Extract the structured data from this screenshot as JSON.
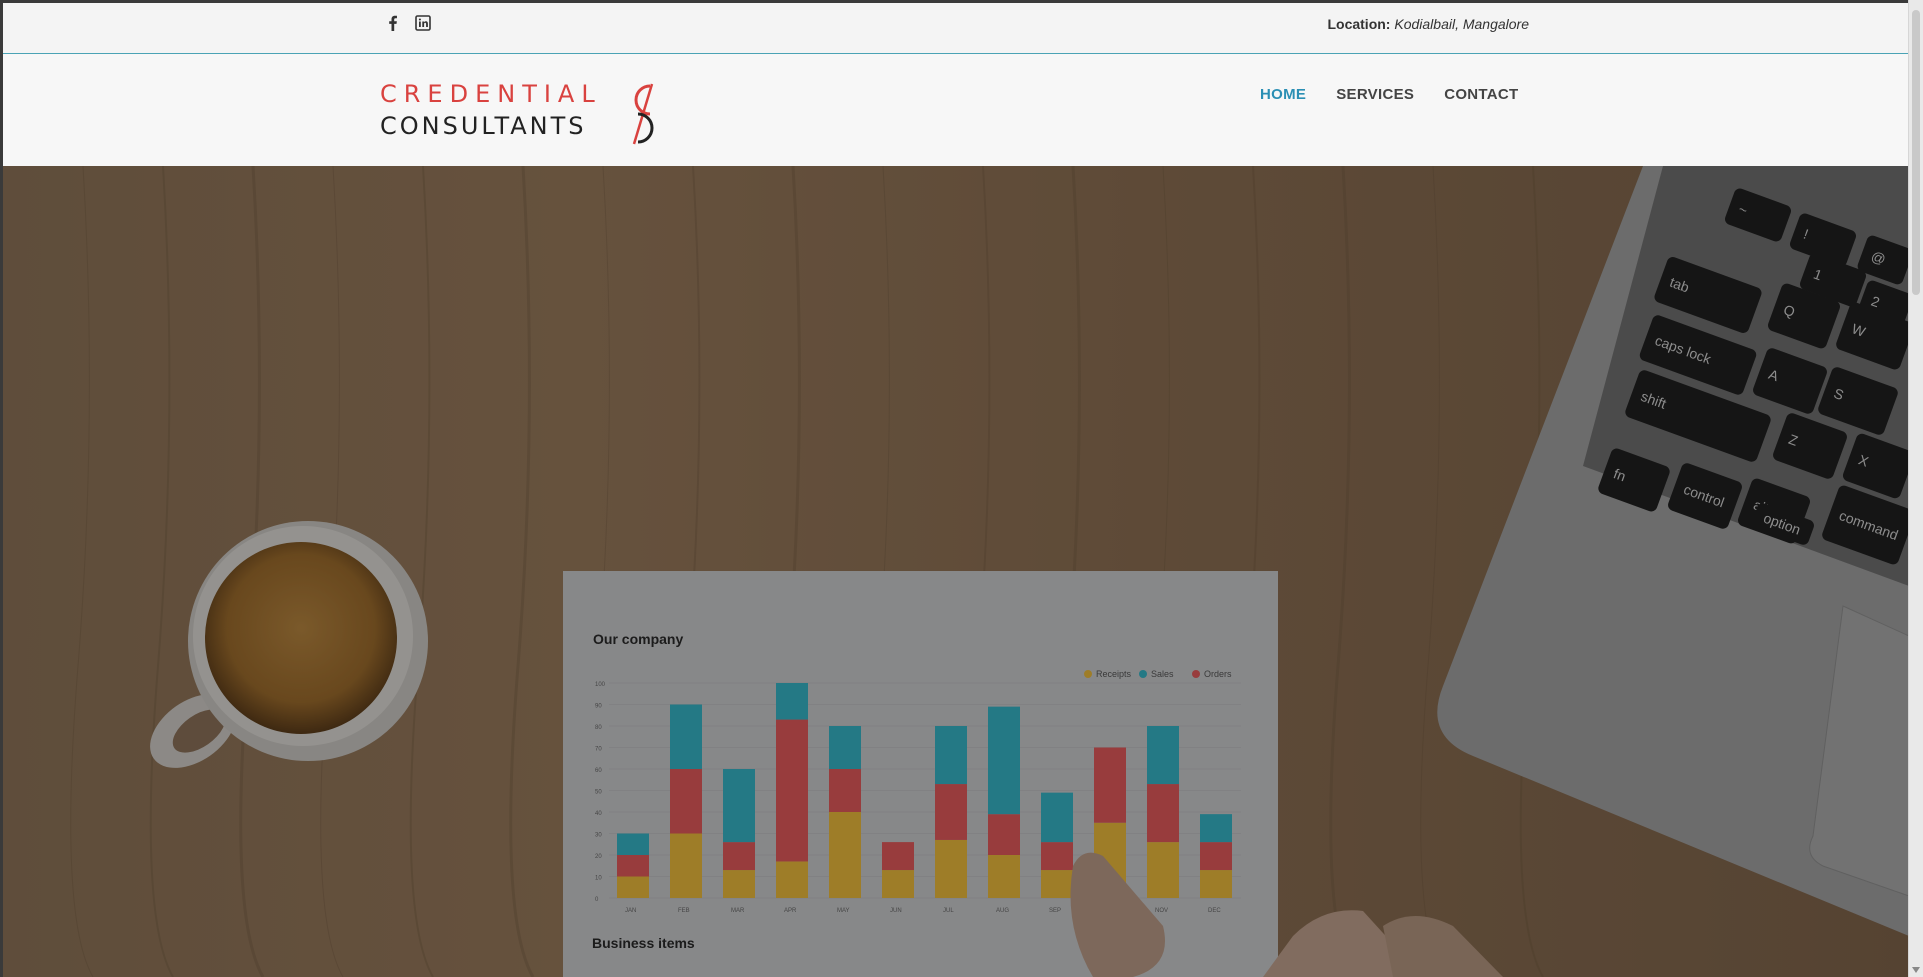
{
  "topbar": {
    "social": [
      {
        "name": "facebook",
        "icon": "facebook-icon"
      },
      {
        "name": "linkedin",
        "icon": "linkedin-icon"
      }
    ],
    "location_label": "Location:",
    "location_value": "Kodialbail, Mangalore"
  },
  "brand": {
    "line1": "CREDENTIAL",
    "line2": "CONSULTANTS",
    "accent_color": "#d9423f",
    "text_color": "#222222"
  },
  "nav": {
    "items": [
      {
        "label": "HOME",
        "active": true
      },
      {
        "label": "SERVICES",
        "active": false
      },
      {
        "label": "CONTACT",
        "active": false
      }
    ],
    "active_color": "#2b8fb4"
  },
  "hero": {
    "paper_title": "Our company",
    "paper_footer": "Business items",
    "legend": [
      "Receipts",
      "Sales",
      "Orders"
    ],
    "legend_colors": [
      "#e9b93c",
      "#35b3c4",
      "#e0595a"
    ],
    "months": [
      "JAN",
      "FEB",
      "MAR",
      "APR",
      "MAY",
      "JUN",
      "JUL",
      "AUG",
      "SEP",
      "OCT",
      "NOV",
      "DEC"
    ],
    "receipts": [
      10,
      30,
      13,
      17,
      40,
      13,
      27,
      20,
      13,
      35,
      26,
      13
    ],
    "orders": [
      10,
      30,
      13,
      66,
      20,
      13,
      26,
      19,
      13,
      35,
      27,
      13
    ],
    "sales": [
      10,
      30,
      34,
      17,
      20,
      0,
      27,
      50,
      23,
      0,
      27,
      13
    ],
    "y_ticks": [
      "0",
      "10",
      "20",
      "30",
      "40",
      "50",
      "60",
      "70",
      "80",
      "90",
      "100"
    ],
    "keyboard_keys": [
      "~",
      "!",
      "1",
      "@",
      "2",
      "tab",
      "Q",
      "W",
      "caps lock",
      "A",
      "S",
      "shift",
      "Z",
      "X",
      "fn",
      "control",
      "alt",
      "option",
      "command"
    ]
  }
}
